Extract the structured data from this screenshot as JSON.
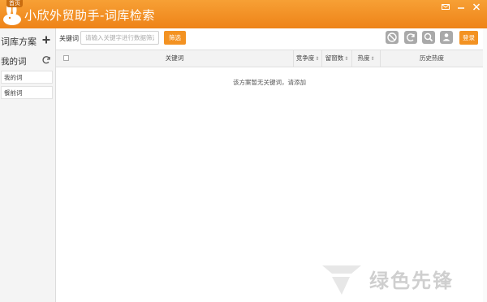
{
  "app": {
    "home_tag": "首页",
    "title": "小欣外贸助手-词库检索"
  },
  "sidebar": {
    "title": "词库方案",
    "mine_label": "我的词",
    "items": [
      {
        "label": "我的词"
      },
      {
        "label": "餐前词"
      }
    ]
  },
  "toolbar": {
    "keyword_label": "关键词",
    "keyword_value": "",
    "keyword_placeholder": "请输入关键字进行数据筛选",
    "filter_label": "筛选",
    "login_label": "登录",
    "icons": [
      "block-icon",
      "refresh-icon",
      "search-icon",
      "user-icon"
    ]
  },
  "table": {
    "columns": [
      {
        "label": "关键词",
        "sortable": false
      },
      {
        "label": "竞争度",
        "sortable": true
      },
      {
        "label": "留窗数",
        "sortable": true
      },
      {
        "label": "热度",
        "sortable": true
      },
      {
        "label": "历史热度",
        "sortable": false
      }
    ],
    "empty_message": "该方案暂无关键词，请添加"
  },
  "watermark": {
    "text": "绿色先锋"
  },
  "colors": {
    "brand_orange": "#f39222",
    "title_gradient_top": "#f7a035",
    "title_gradient_bottom": "#ee8318"
  }
}
